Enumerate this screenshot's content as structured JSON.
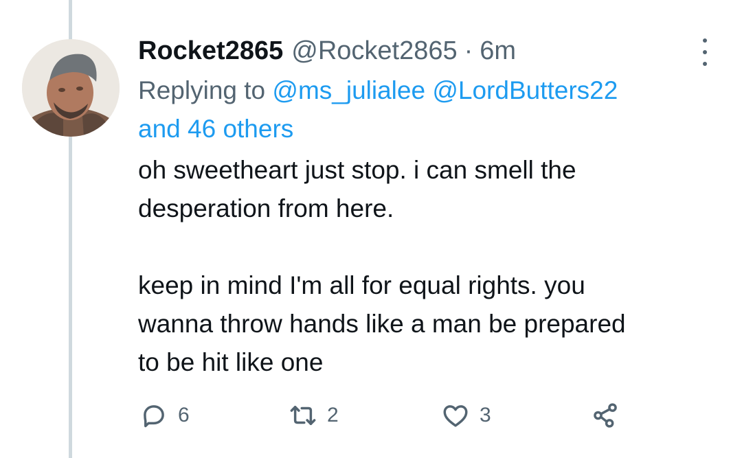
{
  "tweet": {
    "display_name": "Rocket2865",
    "handle": "@Rocket2865",
    "separator": "·",
    "time": "6m",
    "reply_prefix": "Replying to",
    "mentions": [
      "@ms_julialee",
      "@LordButters22"
    ],
    "others": "and 46 others",
    "text_lines": [
      "oh sweetheart just stop. i can smell the",
      "desperation from here.",
      "keep in mind I'm all for equal rights. you",
      "wanna throw hands like a man be prepared",
      "to be hit like one"
    ]
  },
  "actions": {
    "reply_count": "6",
    "retweet_count": "2",
    "like_count": "3"
  },
  "colors": {
    "link": "#1d9bf0",
    "secondary_text": "#536471",
    "primary_text": "#0f1419",
    "thread_line": "#cfd9de"
  },
  "icons": [
    "more-icon",
    "reply-icon",
    "retweet-icon",
    "like-icon",
    "share-icon"
  ]
}
